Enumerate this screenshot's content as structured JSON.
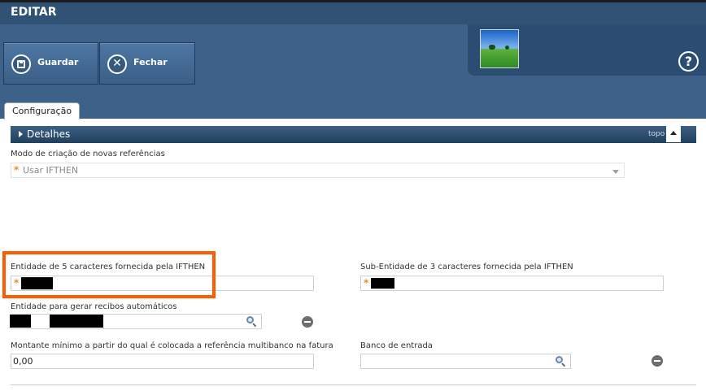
{
  "header": {
    "title": "EDITAR"
  },
  "toolbar": {
    "save_label": "Guardar",
    "close_label": "Fechar",
    "help_label": "?"
  },
  "tabs": [
    {
      "label": "Configuração"
    }
  ],
  "section": {
    "title": "Detalhes",
    "topo_label": "topo"
  },
  "form": {
    "mode_label": "Modo de criação de novas referências",
    "mode_value": "Usar IFTHEN",
    "entity5_label": "Entidade de 5 caracteres fornecida pela IFTHEN",
    "subentity3_label": "Sub-Entidade de 3 caracteres fornecida pela IFTHEN",
    "receipt_entity_label": "Entidade para gerar recibos automáticos",
    "min_amount_label": "Montante mínimo a partir do qual é colocada a referência multibanco na fatura",
    "min_amount_value": "0,00",
    "bank_label": "Banco de entrada",
    "required_mark": "*"
  },
  "icons": {
    "save": "save-icon",
    "close": "close-icon",
    "help": "help-icon",
    "search": "search-icon",
    "remove": "remove-icon",
    "dropdown": "chevron-down-icon"
  },
  "colors": {
    "header": "#2f5275",
    "toolbar": "#3d6189",
    "highlight": "#ff5a00",
    "required": "#f08a24"
  }
}
